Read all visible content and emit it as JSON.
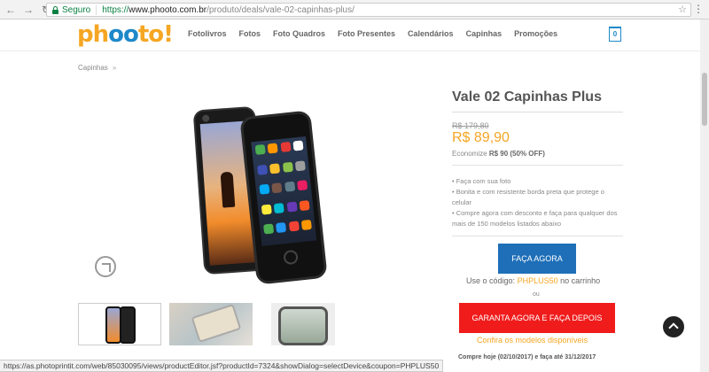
{
  "browser": {
    "secure_label": "Seguro",
    "url_scheme": "https://",
    "url_host": "www.phooto.com.br",
    "url_path": "/produto/deals/vale-02-capinhas-plus/",
    "status_url": "https://as.photoprintit.com/web/85030095/views/productEditor.jsf?productId=7324&showDialog=selectDevice&coupon=PHPLUS50"
  },
  "header": {
    "logo_pre": "ph",
    "logo_eyes": "oo",
    "logo_post": "to!",
    "nav": [
      "Fotolivros",
      "Fotos",
      "Foto Quadros",
      "Foto Presentes",
      "Calendários",
      "Capinhas",
      "Promoções"
    ],
    "cart_count": "0"
  },
  "breadcrumb": {
    "label": "Capinhas",
    "sep": "»"
  },
  "product": {
    "title": "Vale 02 Capinhas Plus",
    "old_price": "R$ 179,80",
    "price": "R$ 89,90",
    "economy_label": "Economize",
    "economy_value": "R$ 90 (50% OFF)",
    "features": [
      "• Faça com sua foto",
      "• Bonita e com resistente borda preta que protege o celular",
      "• Compre agora com desconto e faça para qualquer dos mais de 150 modelos listados abaixo"
    ],
    "primary_cta": "FAÇA AGORA",
    "coupon_prefix": "Use o código:",
    "coupon_code": "PHPLUS50",
    "coupon_suffix": "no carrinho",
    "or": "ou",
    "secondary_cta": "GARANTA AGORA E FAÇA DEPOIS",
    "models_link": "Confira os modelos disponíveis",
    "deadline": "Compre hoje (02/10/2017) e faça até 31/12/2017"
  },
  "colors": {
    "brand_orange": "#f5a623",
    "brand_blue": "#1e6fb8",
    "cta_red": "#f01c1c"
  }
}
